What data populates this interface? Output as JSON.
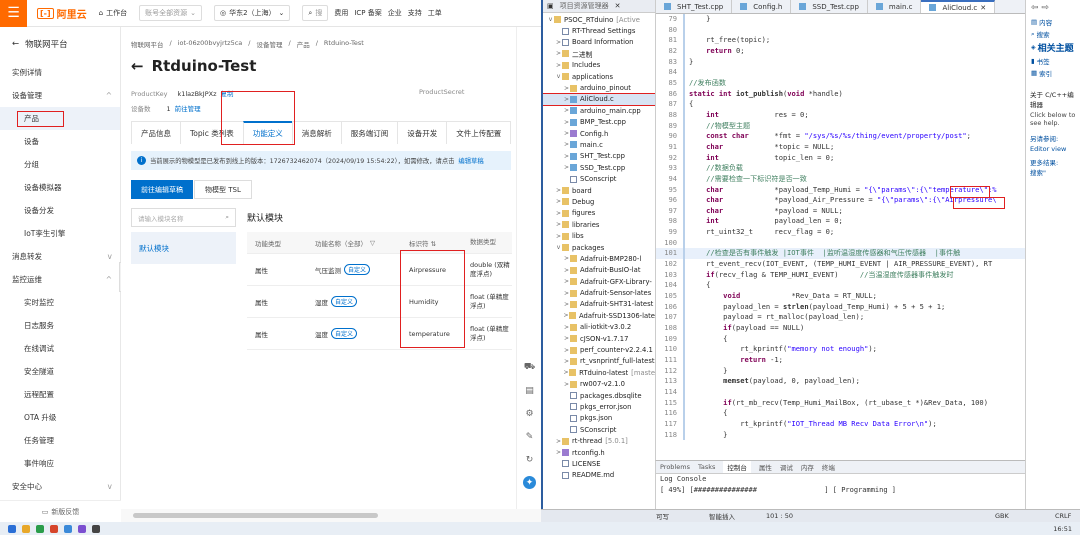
{
  "topbar": {
    "menu_icon": "menu-icon",
    "logo_text": "阿里云",
    "workbench": "工作台",
    "account_placeholder": "账号全部资源",
    "region": "华东2（上海）",
    "search": "搜",
    "right_items": [
      "费用",
      "ICP 备案",
      "企业",
      "支持",
      "工单"
    ]
  },
  "sidebar": {
    "back_label": "物联网平台",
    "items": [
      {
        "label": "实例详情",
        "level": 0
      },
      {
        "label": "设备管理",
        "level": 0,
        "expand": "^"
      },
      {
        "label": "产品",
        "level": 1,
        "active": true
      },
      {
        "label": "设备",
        "level": 1
      },
      {
        "label": "分组",
        "level": 1
      },
      {
        "label": "设备模拟器",
        "level": 1
      },
      {
        "label": "设备分发",
        "level": 1
      },
      {
        "label": "IoT孪生引擎",
        "level": 1
      },
      {
        "label": "消息转发",
        "level": 0,
        "expand": "v"
      },
      {
        "label": "监控运维",
        "level": 0,
        "expand": "^"
      },
      {
        "label": "实时监控",
        "level": 1
      },
      {
        "label": "日志服务",
        "level": 1
      },
      {
        "label": "在线调试",
        "level": 1
      },
      {
        "label": "安全隧道",
        "level": 1
      },
      {
        "label": "远程配置",
        "level": 1
      },
      {
        "label": "OTA 升级",
        "level": 1
      },
      {
        "label": "任务管理",
        "level": 1
      },
      {
        "label": "事件响应",
        "level": 1
      },
      {
        "label": "安全中心",
        "level": 0,
        "expand": "v"
      }
    ],
    "footer": "新版反馈"
  },
  "main": {
    "breadcrumb": [
      "物联网平台",
      "/",
      "iot-06z00bvyjrtz5ca",
      "/",
      "设备管理",
      "/",
      "产品",
      "/",
      "Rtduino-Test"
    ],
    "title": "Rtduino-Test",
    "product_key_label": "ProductKey",
    "product_key": "k1lazBkJPXz",
    "copy": "复制",
    "product_secret_label": "ProductSecret",
    "device_count_label": "设备数",
    "device_count": "1",
    "goto_manage": "前往管理",
    "tabs": [
      "产品信息",
      "Topic 类列表",
      "功能定义",
      "消息解析",
      "服务端订阅",
      "设备开发",
      "文件上传配置"
    ],
    "notice": "当前展示的物模型是已发布到线上的版本：1726732462074（2024/09/19 15:54:22），如需修改，请点击",
    "notice_link": "编辑草稿",
    "btn_edit": "前往编辑草稿",
    "btn_tsl": "物模型 TSL",
    "search_placeholder": "请输入模块名称",
    "module_default": "默认模块",
    "module_title": "默认模块",
    "table_headers": [
      "功能类型",
      "功能名称（全部）",
      "标识符 ⇅",
      "数据类型"
    ],
    "rows": [
      {
        "type": "属性",
        "name": "气压监测",
        "tag": "自定义",
        "id": "Airpressure",
        "dtype": "double (双精度浮点)"
      },
      {
        "type": "属性",
        "name": "湿度",
        "tag": "自定义",
        "id": "Humidity",
        "dtype": "float (单精度浮点)"
      },
      {
        "type": "属性",
        "name": "温度",
        "tag": "自定义",
        "id": "temperature",
        "dtype": "float (单精度浮点)"
      }
    ]
  },
  "ide": {
    "tree_header": [
      "项目资源管理器",
      "✕"
    ],
    "tree": [
      {
        "t": "v",
        "i": "fold",
        "l": "PSOC_RTduino",
        "extra": "[Active",
        "d": 0
      },
      {
        "t": "",
        "i": "file",
        "l": "RT-Thread Settings",
        "d": 1
      },
      {
        "t": ">",
        "i": "file",
        "l": "Board Information",
        "d": 1
      },
      {
        "t": ">",
        "i": "fold",
        "l": "二进制",
        "d": 1
      },
      {
        "t": ">",
        "i": "fold",
        "l": "Includes",
        "d": 1
      },
      {
        "t": "v",
        "i": "fold",
        "l": "applications",
        "d": 1
      },
      {
        "t": ">",
        "i": "fold",
        "l": "arduino_pinout",
        "d": 2
      },
      {
        "t": ">",
        "i": "cpp",
        "l": "AliCloud.c",
        "d": 2,
        "sel": true
      },
      {
        "t": ">",
        "i": "cpp",
        "l": "arduino_main.cpp",
        "d": 2
      },
      {
        "t": ">",
        "i": "cpp",
        "l": "BMP_Test.cpp",
        "d": 2
      },
      {
        "t": ">",
        "i": "h",
        "l": "Config.h",
        "d": 2
      },
      {
        "t": ">",
        "i": "cpp",
        "l": "main.c",
        "d": 2
      },
      {
        "t": ">",
        "i": "cpp",
        "l": "SHT_Test.cpp",
        "d": 2
      },
      {
        "t": ">",
        "i": "cpp",
        "l": "SSD_Test.cpp",
        "d": 2
      },
      {
        "t": "",
        "i": "file",
        "l": "SConscript",
        "d": 2
      },
      {
        "t": ">",
        "i": "fold",
        "l": "board",
        "d": 1
      },
      {
        "t": ">",
        "i": "fold",
        "l": "Debug",
        "d": 1
      },
      {
        "t": ">",
        "i": "fold",
        "l": "figures",
        "d": 1
      },
      {
        "t": ">",
        "i": "fold",
        "l": "libraries",
        "d": 1
      },
      {
        "t": ">",
        "i": "fold",
        "l": "libs",
        "d": 1
      },
      {
        "t": "v",
        "i": "fold",
        "l": "packages",
        "d": 1
      },
      {
        "t": ">",
        "i": "fold",
        "l": "Adafruit-BMP280-l",
        "d": 2
      },
      {
        "t": ">",
        "i": "fold",
        "l": "Adafruit-BusIO-lat",
        "d": 2
      },
      {
        "t": ">",
        "i": "fold",
        "l": "Adafruit-GFX-Library-",
        "d": 2
      },
      {
        "t": ">",
        "i": "fold",
        "l": "Adafruit-Sensor-lates",
        "d": 2
      },
      {
        "t": ">",
        "i": "fold",
        "l": "Adafruit-SHT31-latest",
        "d": 2
      },
      {
        "t": ">",
        "i": "fold",
        "l": "Adafruit-SSD1306-late",
        "d": 2
      },
      {
        "t": ">",
        "i": "fold",
        "l": "ali-iotkit-v3.0.2",
        "d": 2
      },
      {
        "t": ">",
        "i": "fold",
        "l": "cJSON-v1.7.17",
        "d": 2
      },
      {
        "t": ">",
        "i": "fold",
        "l": "perf_counter-v2.2.4.1",
        "d": 2
      },
      {
        "t": ">",
        "i": "fold",
        "l": "rt_vsnprintf_full-latest",
        "d": 2
      },
      {
        "t": ">",
        "i": "fold",
        "l": "RTduino-latest",
        "extra": "[maste",
        "d": 2
      },
      {
        "t": ">",
        "i": "fold",
        "l": "rw007-v2.1.0",
        "d": 2
      },
      {
        "t": "",
        "i": "file",
        "l": "packages.dbsqlite",
        "d": 2
      },
      {
        "t": "",
        "i": "file",
        "l": "pkgs_error.json",
        "d": 2
      },
      {
        "t": "",
        "i": "file",
        "l": "pkgs.json",
        "d": 2
      },
      {
        "t": "",
        "i": "file",
        "l": "SConscript",
        "d": 2
      },
      {
        "t": ">",
        "i": "fold",
        "l": "rt-thread",
        "extra": "[5.0.1]",
        "d": 1
      },
      {
        "t": ">",
        "i": "h",
        "l": "rtconfig.h",
        "d": 1
      },
      {
        "t": "",
        "i": "file",
        "l": "LICENSE",
        "d": 1
      },
      {
        "t": "",
        "i": "file",
        "l": "README.md",
        "d": 1
      }
    ],
    "editor_tabs": [
      {
        "label": "SHT_Test.cpp"
      },
      {
        "label": "Config.h"
      },
      {
        "label": "SSD_Test.cpp"
      },
      {
        "label": "main.c"
      },
      {
        "label": "AliCloud.c",
        "active": true
      }
    ],
    "code": [
      {
        "n": "79",
        "h": "    }"
      },
      {
        "n": "80",
        "h": ""
      },
      {
        "n": "81",
        "h": "    rt_free(topic);"
      },
      {
        "n": "82",
        "h": "    <span class='kw'>return</span> 0;"
      },
      {
        "n": "83",
        "h": "}"
      },
      {
        "n": "84",
        "h": ""
      },
      {
        "n": "85",
        "h": "<span class='cm'>//发布函数</span>"
      },
      {
        "n": "86",
        "h": "<span class='kw'>static int</span> <b>iot_publish</b>(<span class='kw'>void</span> *handle)"
      },
      {
        "n": "87",
        "h": "{"
      },
      {
        "n": "88",
        "h": "    <span class='kw'>int</span>             res = 0;"
      },
      {
        "n": "89",
        "h": "    <span class='cm'>//物模型主题</span>"
      },
      {
        "n": "90",
        "h": "    <span class='kw'>const char</span>      *fmt = <span class='st'>\"/sys/%s/%s/thing/event/property/post\"</span>;"
      },
      {
        "n": "91",
        "h": "    <span class='kw'>char</span>            *topic = NULL;"
      },
      {
        "n": "92",
        "h": "    <span class='kw'>int</span>             topic_len = 0;"
      },
      {
        "n": "93",
        "h": "    <span class='cm'>//数据负载</span>"
      },
      {
        "n": "94",
        "h": "    <span class='cm'>//需要检查一下标识符是否一致</span>"
      },
      {
        "n": "95",
        "h": "    <span class='kw'>char</span>            *payload_Temp_Humi = <span class='st'>\"{\\\"params\\\":{\\\"temperature\\\":%</span>"
      },
      {
        "n": "96",
        "h": "    <span class='kw'>char</span>            *payload_Air_Pressure = <span class='st'>\"{\\\"params\\\":{\\\"Airpressure\\</span>"
      },
      {
        "n": "97",
        "h": "    <span class='kw'>char</span>            *payload = NULL;"
      },
      {
        "n": "98",
        "h": "    <span class='kw'>int</span>             payload_len = 0;"
      },
      {
        "n": "99",
        "h": "    rt_uint32_t     recv_flag = 0;"
      },
      {
        "n": "100",
        "h": ""
      },
      {
        "n": "101",
        "h": "    <span class='cm'>//检查是否有事件触发 |IOT事件  |监听温湿度传感器和气压传感器  |事件触</span>",
        "hl": true
      },
      {
        "n": "102",
        "h": "    rt_event_recv(IOT_EVENT, (TEMP_HUMI_EVENT | AIR_PRESSURE_EVENT), RT"
      },
      {
        "n": "103",
        "h": "    <span class='kw'>if</span>(recv_flag &amp; TEMP_HUMI_EVENT)     <span class='cm'>//当温湿度传感器事件触发时</span>"
      },
      {
        "n": "104",
        "h": "    {"
      },
      {
        "n": "105",
        "h": "        <span class='kw'>void</span>            *Rev_Data = RT_NULL;"
      },
      {
        "n": "106",
        "h": "        payload_len = <b>strlen</b>(payload_Temp_Humi) + 5 + 5 + 1;"
      },
      {
        "n": "107",
        "h": "        payload = rt_malloc(payload_len);"
      },
      {
        "n": "108",
        "h": "        <span class='kw'>if</span>(payload == NULL)"
      },
      {
        "n": "109",
        "h": "        {"
      },
      {
        "n": "110",
        "h": "            rt_kprintf(<span class='st'>\"memory not enough\"</span>);"
      },
      {
        "n": "111",
        "h": "            <span class='kw'>return</span> -1;"
      },
      {
        "n": "112",
        "h": "        }"
      },
      {
        "n": "113",
        "h": "        <b>memset</b>(payload, 0, payload_len);"
      },
      {
        "n": "114",
        "h": ""
      },
      {
        "n": "115",
        "h": "        <span class='kw'>if</span>(rt_mb_recv(Temp_Humi_MailBox, (rt_ubase_t *)&amp;Rev_Data, 100)"
      },
      {
        "n": "116",
        "h": "        {"
      },
      {
        "n": "117",
        "h": "            rt_kprintf(<span class='st'>\"IOT_Thread MB Recv Data Error\\n\"</span>);"
      },
      {
        "n": "118",
        "h": "        }"
      }
    ],
    "console_tabs": [
      "Problems",
      "Tasks",
      "控制台",
      "属性",
      "调试",
      "内存",
      "终端"
    ],
    "console_title": "Log Console",
    "console_line": "[ 49%] [###############                ] [ Programming ]",
    "outline": {
      "top_icons": "⇦ ⇨",
      "items": [
        "内容",
        "搜索",
        "相关主题",
        "书签",
        "索引"
      ],
      "about": "关于 C/C++编辑器",
      "about_text": "Click below to see help.",
      "links_title": "另请参阅:",
      "link1": "Editor view",
      "more": "更多结果:",
      "search_link": "搜索\""
    },
    "status": {
      "writable": "可写",
      "insert": "智能插入",
      "pos": "101 : 50",
      "encoding": "GBK",
      "eol": "CRLF"
    }
  },
  "taskbar": {
    "time": "16:51"
  }
}
